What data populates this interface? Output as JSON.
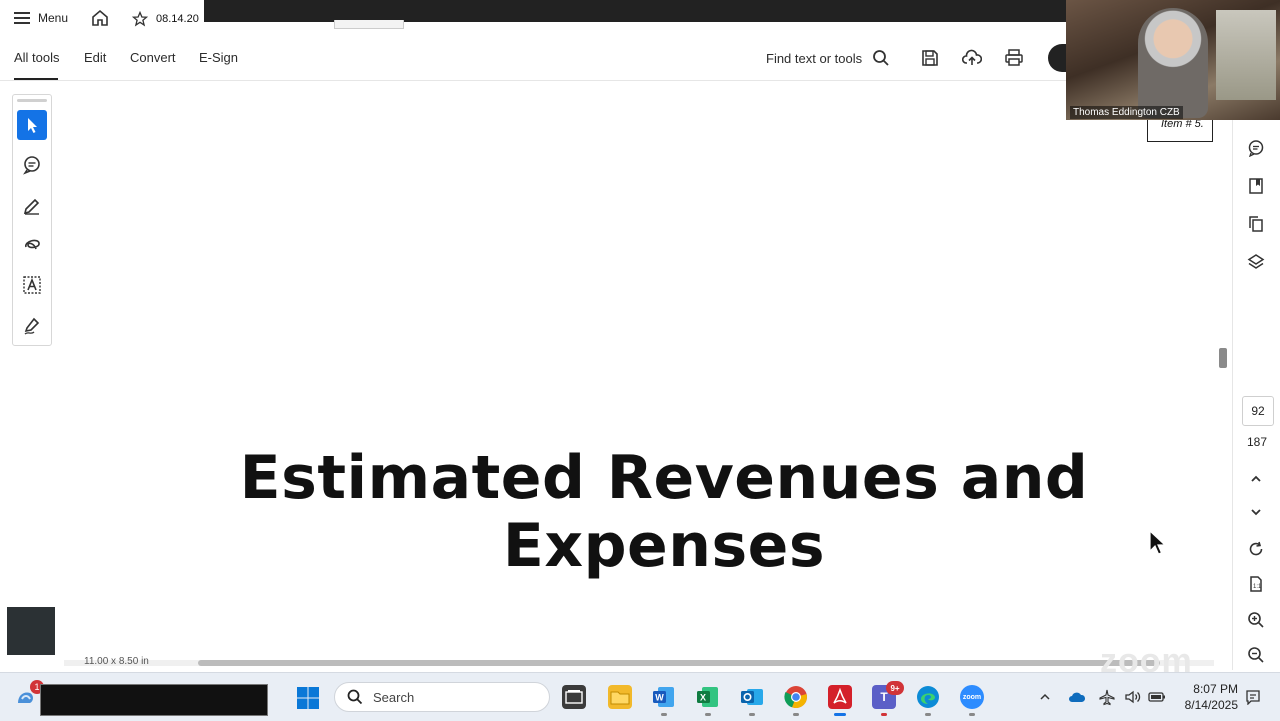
{
  "tab_bar": {
    "menu_label": "Menu",
    "doc_tab_title": "08.14.20"
  },
  "toolbar": {
    "tabs": [
      "All tools",
      "Edit",
      "Convert",
      "E-Sign"
    ],
    "find_label": "Find text or tools"
  },
  "document": {
    "title_line1": "Estimated Revenues and",
    "title_line2": "Expenses",
    "item_label": "Item # 5.",
    "page_size": "11.00 x 8.50 in"
  },
  "navigation": {
    "current_page": "92",
    "total_pages": "187"
  },
  "video": {
    "participant_name": "Thomas Eddington CZB"
  },
  "taskbar": {
    "search_placeholder": "Search",
    "notification_count": "1",
    "teams_badge": "9+",
    "time": "8:07 PM",
    "date": "8/14/2025"
  },
  "colors": {
    "accent": "#1473e6",
    "acrobat_red": "#d4202a",
    "excel_green": "#107c41",
    "word_blue": "#185abd"
  }
}
